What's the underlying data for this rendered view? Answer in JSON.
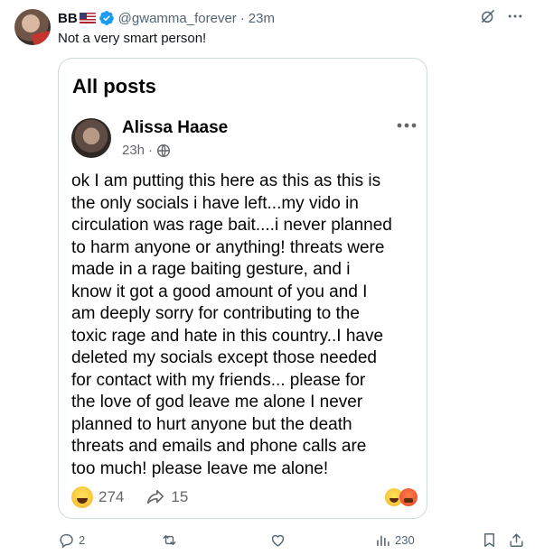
{
  "tweet": {
    "display_name": "BB",
    "handle": "@gwamma_forever",
    "separator": "·",
    "time": "23m",
    "text": "Not a very smart person!",
    "icons": [
      "grok-icon",
      "more-icon"
    ]
  },
  "quoted_post": {
    "section_title": "All posts",
    "author": "Alissa Haase",
    "time": "23h",
    "separator": "·",
    "visibility_icon": "globe-icon",
    "body": "ok I am putting this here as this as this is\nthe only socials i have left...my vido in\ncirculation was rage bait....i never planned\nto harm anyone or anything! threats were\nmade in a rage baiting gesture, and i\nknow it got a good amount of you and I\nam deeply sorry for contributing to the\ntoxic rage and hate in this country..I have\ndeleted my socials except those needed\nfor contact with my friends... please for\nthe love of god leave me alone I never\nplanned to hurt anyone but the death\nthreats and emails and phone calls are\ntoo much! please leave me alone!",
    "reaction_count": "274",
    "share_count": "15"
  },
  "actions": {
    "replies": "2",
    "reposts": "",
    "likes": "",
    "views": "230"
  },
  "colors": {
    "text": "#0f1419",
    "muted": "#536471",
    "border": "#cfd9de",
    "verified": "#1d9bf0"
  }
}
